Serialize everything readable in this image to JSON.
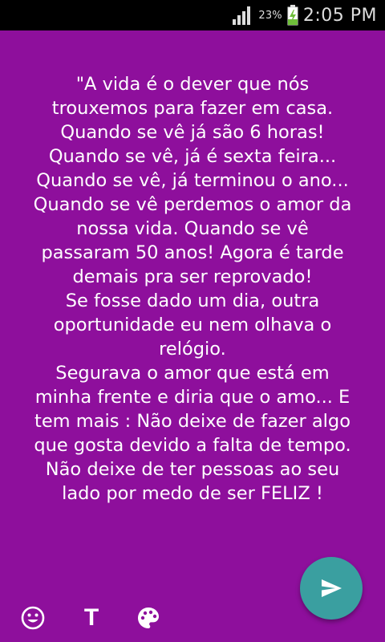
{
  "status_bar": {
    "battery_percent": "23%",
    "time": "2:05 PM",
    "icons": [
      "signal-icon",
      "battery-charging-icon"
    ]
  },
  "colors": {
    "background": "#8e0f9c",
    "text": "#ffffff",
    "fab": "#3a9fa0"
  },
  "quote": {
    "text": "\"A vida é o dever que nós\ntrouxemos para fazer em casa.\nQuando se vê já são 6 horas!\nQuando se vê, já é sexta feira...\nQuando se vê, já terminou o ano...\nQuando se vê perdemos o amor da\nnossa vida. Quando se vê\npassaram 50 anos! Agora é tarde\ndemais pra ser reprovado!\nSe fosse dado um dia, outra\noportunidade eu nem olhava o\nrelógio.\nSegurava o amor que está em\nminha frente e diria que o amo... E\ntem mais : Não deixe de fazer algo\nque gosta devido a falta de tempo.\nNão deixe de ter pessoas ao seu\nlado por medo de ser FELIZ !"
  },
  "toolbar": {
    "text_tool_label": "T",
    "icons": [
      "emoji-icon",
      "text-icon",
      "palette-icon",
      "send-icon"
    ]
  }
}
